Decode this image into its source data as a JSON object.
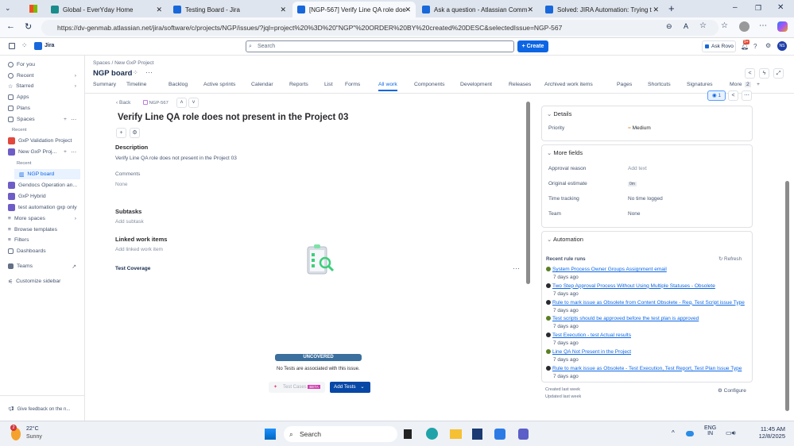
{
  "browser": {
    "tabs": [
      {
        "title": "Global - EverYday Home",
        "color": "#1a8c8c"
      },
      {
        "title": "Testing Board - Jira",
        "color": "#1868db"
      },
      {
        "title": "[NGP-567] Verify Line QA role doe",
        "color": "#1868db",
        "active": true
      },
      {
        "title": "Ask a question - Atlassian Comm",
        "color": "#1868db"
      },
      {
        "title": "Solved: JIRA Automation: Trying t",
        "color": "#1868db"
      }
    ],
    "url": "https://dv-genmab.atlassian.net/jira/software/c/projects/NGP/issues/?jql=project%20%3D%20\"NGP\"%20ORDER%20BY%20created%20DESC&selectedIssue=NGP-567"
  },
  "jira": {
    "app_name": "Jira",
    "search_placeholder": "Search",
    "create_label": "+ Create",
    "ask_rovo": "Ask Rovo",
    "notif_badge": "9+",
    "avatar": "NS"
  },
  "sidebar": {
    "for_you": "For you",
    "recent": "Recent",
    "starred": "Starred",
    "apps": "Apps",
    "plans": "Plans",
    "spaces": "Spaces",
    "recent_header": "Recent",
    "projects": [
      {
        "label": "GxP Validation Project",
        "color": "#e2483d"
      },
      {
        "label": "New GxP Proj...",
        "color": "#6e5dc6"
      }
    ],
    "sub_recent": "Recent",
    "ngp_board": "NGP board",
    "more_projects": [
      {
        "label": "Gendocs Operation an...",
        "color": "#6e5dc6"
      },
      {
        "label": "GxP Hybrid",
        "color": "#6e5dc6"
      },
      {
        "label": "test automation gxp only",
        "color": "#6e5dc6"
      }
    ],
    "more_spaces": "More spaces",
    "browse_templates": "Browse templates",
    "filters": "Filters",
    "dashboards": "Dashboards",
    "teams": "Teams",
    "customize": "Customize sidebar",
    "feedback": "Give feedback on the n..."
  },
  "board": {
    "breadcrumb_spaces": "Spaces",
    "breadcrumb_project": "New GxP Project",
    "title": "NGP board",
    "nav": [
      "Summary",
      "Timeline",
      "Backlog",
      "Active sprints",
      "Calendar",
      "Reports",
      "List",
      "Forms",
      "All work",
      "Components",
      "Development",
      "Releases",
      "Archived work items",
      "Pages",
      "Shortcuts",
      "Signatures",
      "More"
    ],
    "more_count": "2"
  },
  "issue": {
    "back": "Back",
    "key": "NGP-567",
    "title": "Verify Line QA role does not present in the Project 03",
    "description_label": "Description",
    "description": "Verify Line QA role does not present in the Project 03",
    "comments_label": "Comments",
    "comments": "None",
    "subtasks_label": "Subtasks",
    "add_subtask": "Add subtask",
    "linked_label": "Linked work items",
    "add_linked": "Add linked work item",
    "coverage_label": "Test Coverage",
    "coverage_status": "UNCOVERED",
    "coverage_msg": "No Tests are associated with this issue.",
    "test_cases": "Test Cases",
    "beta": "BETA",
    "add_tests": "Add Tests"
  },
  "details": {
    "watch_count": "1",
    "details_label": "Details",
    "priority_label": "Priority",
    "priority": "Medium",
    "more_fields_label": "More fields",
    "fields": [
      {
        "label": "Approval reason",
        "value": "Add text"
      },
      {
        "label": "Original estimate",
        "value": "0m"
      },
      {
        "label": "Time tracking",
        "value": "No time logged"
      },
      {
        "label": "Team",
        "value": "None"
      }
    ],
    "automation_label": "Automation",
    "recent_runs": "Recent rule runs",
    "refresh": "Refresh",
    "runs": [
      {
        "name": "System Process Owner Groups Assignment email",
        "ago": "7 days ago",
        "status": "success"
      },
      {
        "name": "Two Step Approval Process Without Using Multiple Statuses - Obsolete",
        "ago": "7 days ago",
        "status": "no-action"
      },
      {
        "name": "Rule to mark issue as Obsolete from Content Obsolete - Req, Test Script issue Type",
        "ago": "7 days ago",
        "status": "no-action"
      },
      {
        "name": "Test scripts should be approved before the test plan is approved",
        "ago": "7 days ago",
        "status": "success"
      },
      {
        "name": "Test Execution - test Actual results",
        "ago": "7 days ago",
        "status": "no-action"
      },
      {
        "name": "Line QA Not Present in the Project",
        "ago": "7 days ago",
        "status": "success"
      },
      {
        "name": "Rule to mark issue as Obsolete - Test Execution, Test Report, Test Plan Issue Type",
        "ago": "7 days ago",
        "status": "no-action"
      }
    ],
    "created": "Created last week",
    "updated": "Updated last week",
    "configure": "Configure"
  },
  "taskbar": {
    "weather_badge": "2",
    "temp": "22°C",
    "condition": "Sunny",
    "search": "Search",
    "lang1": "ENG",
    "lang2": "IN",
    "time": "11:45 AM",
    "date": "12/8/2025"
  }
}
